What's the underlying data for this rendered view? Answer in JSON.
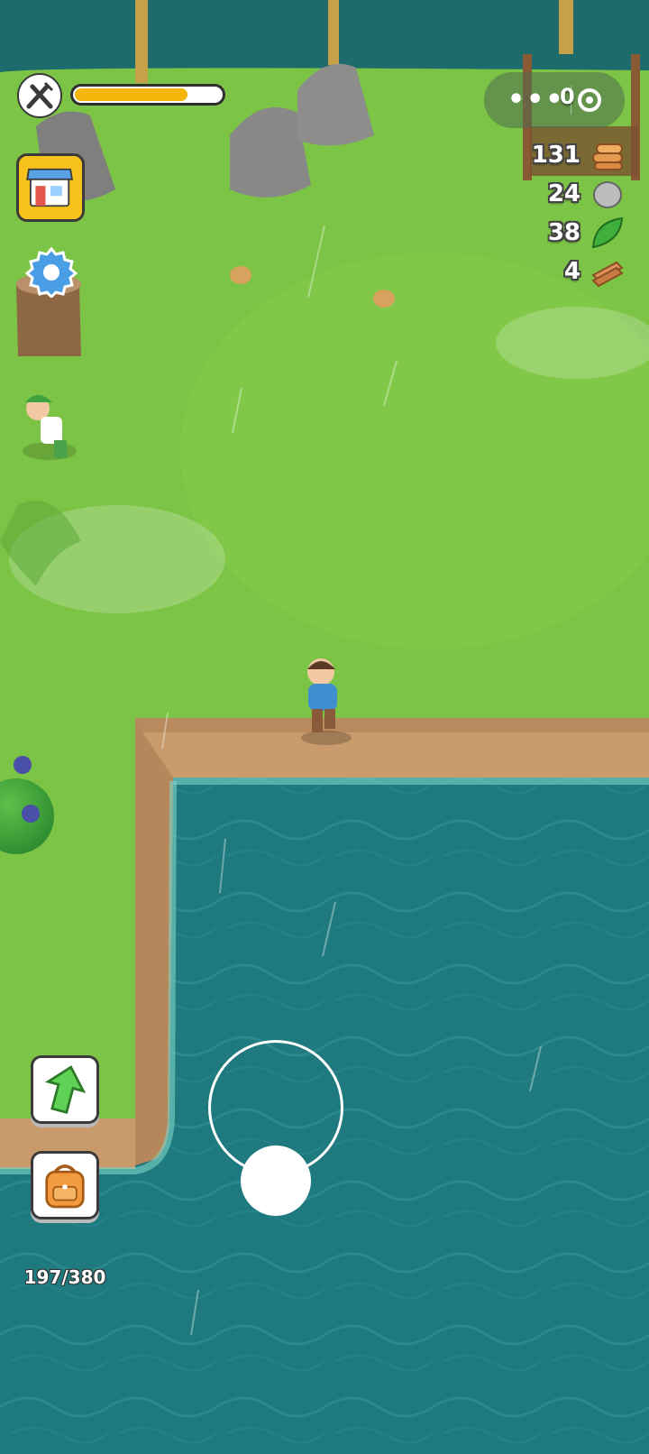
{
  "hud": {
    "hunger": {
      "icon": "fork-knife-icon",
      "level": 0.78,
      "fill_color": "#f5b60c"
    },
    "mini_program_capsule": {
      "more_icon": "more-dots-icon",
      "close_icon": "target-circle-icon"
    },
    "coins": {
      "count": "0",
      "icon": "coin-icon"
    }
  },
  "resources": [
    {
      "name": "wood",
      "count": "131",
      "icon": "wood-logs-icon"
    },
    {
      "name": "stone",
      "count": "24",
      "icon": "stone-icon"
    },
    {
      "name": "leaf",
      "count": "38",
      "icon": "leaf-icon"
    },
    {
      "name": "plank",
      "count": "4",
      "icon": "plank-icon"
    }
  ],
  "buttons": {
    "shop": {
      "icon": "shop-icon"
    },
    "settings": {
      "icon": "gear-icon"
    },
    "upgrade": {
      "icon": "up-arrow-icon"
    },
    "backpack": {
      "icon": "backpack-icon",
      "capacity": "197/380"
    }
  },
  "joystick": {
    "ring_icon": "joystick-ring",
    "knob_icon": "joystick-knob"
  },
  "colors": {
    "grass": "#7cc445",
    "water": "#1f7a7f",
    "dirt": "#c79a6a",
    "accent": "#f7c21c"
  }
}
